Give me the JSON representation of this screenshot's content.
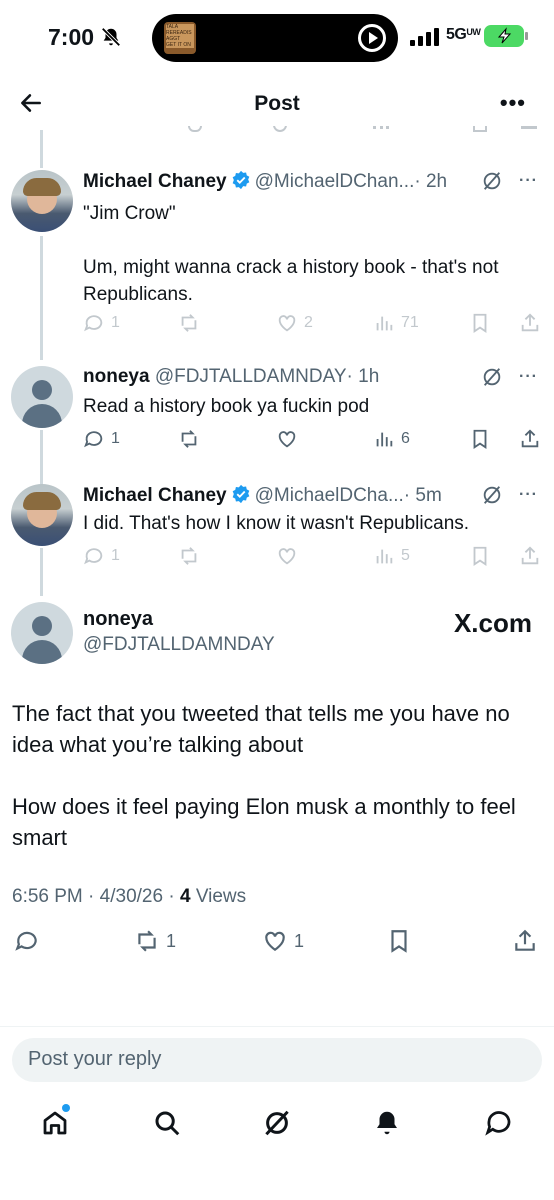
{
  "status_bar": {
    "time": "7:00",
    "network": "5G",
    "network_sub": "UW",
    "island_thumb_text": [
      "TALA",
      "REREADIS",
      "AGGT",
      "GET IT ON"
    ]
  },
  "header": {
    "title": "Post"
  },
  "replies": [
    {
      "name": "Michael Chaney",
      "verified": true,
      "handle": "@MichaelDChan...",
      "time": "· 2h",
      "text": [
        "\"Jim Crow\"",
        "",
        "Um, might wanna crack a history book - that's not Republicans."
      ],
      "stats": {
        "replies": "1",
        "reposts": "",
        "likes": "2",
        "views": "71"
      },
      "faded": true
    },
    {
      "name": "noneya",
      "verified": false,
      "handle": "@FDJTALLDAMNDAY",
      "time": "· 1h",
      "text": [
        "Read a history book ya fuckin pod"
      ],
      "stats": {
        "replies": "1",
        "reposts": "",
        "likes": "",
        "views": "6"
      },
      "faded": false
    },
    {
      "name": "Michael Chaney",
      "verified": true,
      "handle": "@MichaelDCha...",
      "time": "· 5m",
      "text": [
        "I did.  That's how I know it wasn't Republicans."
      ],
      "stats": {
        "replies": "1",
        "reposts": "",
        "likes": "",
        "views": "5"
      },
      "faded": true
    }
  ],
  "main_post": {
    "name": "noneya",
    "handle": "@FDJTALLDAMNDAY",
    "watermark": "X.com",
    "text_p1": "The fact that you tweeted that tells me you have no idea what you’re talking about",
    "text_p2": "How does it feel paying Elon musk a monthly to feel smart",
    "time": "6:56 PM",
    "date": "4/30/26",
    "views_count": "4",
    "views_label": "Views",
    "reposts": "1",
    "likes": "1"
  },
  "reply_placeholder": "Post your reply",
  "tabs": [
    "home",
    "search",
    "grok",
    "notifications",
    "messages"
  ],
  "colors": {
    "accent": "#1d9bf0",
    "muted": "#536471",
    "text": "#0f1419"
  }
}
